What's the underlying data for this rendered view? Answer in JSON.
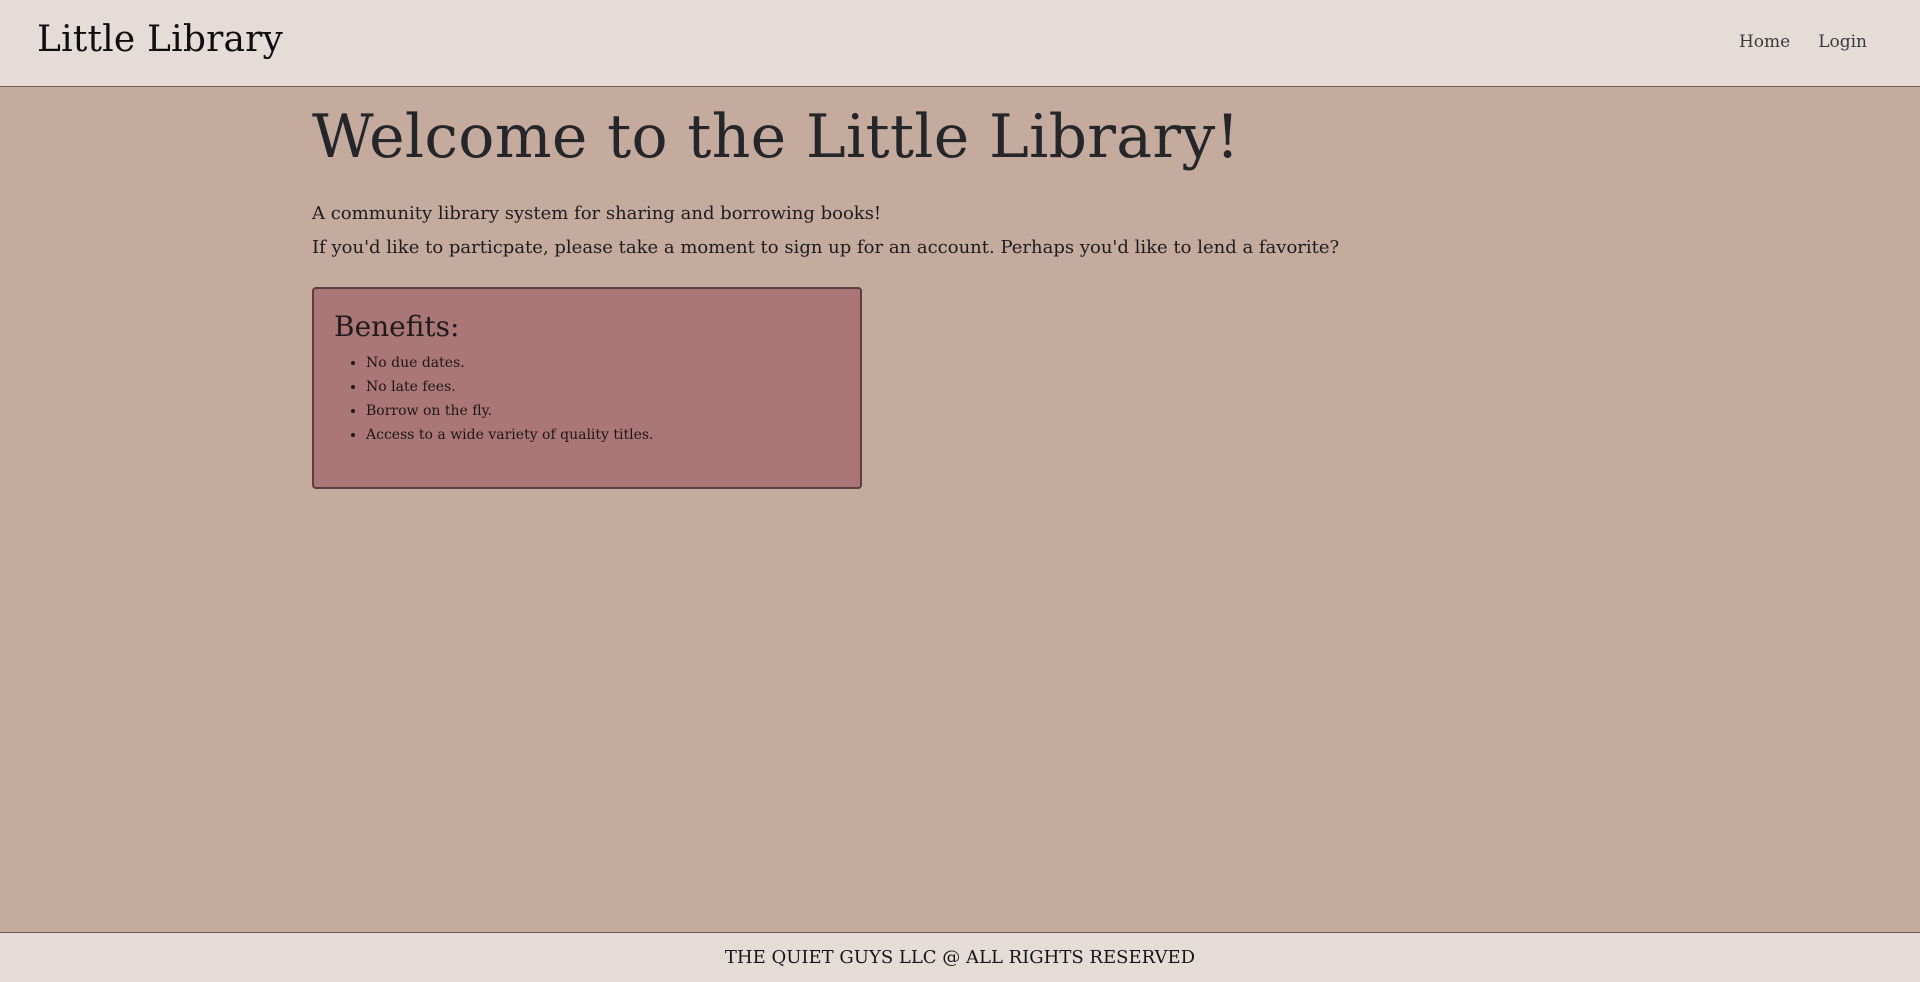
{
  "navbar": {
    "brand": "Little Library",
    "links": [
      "Home",
      "Login"
    ]
  },
  "main": {
    "title": "Welcome to the Little Library!",
    "intro": [
      "A community library system for sharing and borrowing books!",
      "If you'd like to particpate, please take a moment to sign up for an account. Perhaps you'd like to lend a favorite?"
    ],
    "benefits": {
      "title": "Benefits:",
      "items": [
        "No due dates.",
        "No late fees.",
        "Borrow on the fly.",
        "Access to a wide variety of quality titles."
      ]
    }
  },
  "footer": {
    "text": "THE QUIET GUYS LLC @ ALL RIGHTS RESERVED"
  },
  "colors": {
    "page_background": "#c5aa9e",
    "navbar_background": "#e6dcd7",
    "benefits_background": "#ab7776",
    "benefits_border": "#5e3c44"
  }
}
